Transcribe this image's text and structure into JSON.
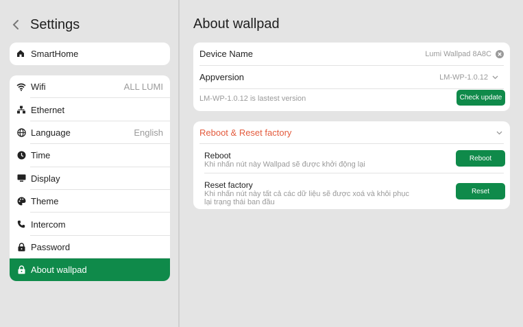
{
  "sidebar": {
    "title": "Settings",
    "home": "SmartHome",
    "items": [
      {
        "label": "Wifi",
        "value": "ALL LUMI",
        "icon": "wifi-icon"
      },
      {
        "label": "Ethernet",
        "value": "",
        "icon": "ethernet-icon"
      },
      {
        "label": "Language",
        "value": "English",
        "icon": "globe-icon"
      },
      {
        "label": "Time",
        "value": "",
        "icon": "clock-icon"
      },
      {
        "label": "Display",
        "value": "",
        "icon": "monitor-icon"
      },
      {
        "label": "Theme",
        "value": "",
        "icon": "palette-icon"
      },
      {
        "label": "Intercom",
        "value": "",
        "icon": "phone-icon"
      },
      {
        "label": "Password",
        "value": "",
        "icon": "lock-icon"
      },
      {
        "label": "About wallpad",
        "value": "",
        "icon": "lock-icon"
      }
    ]
  },
  "main": {
    "title": "About wallpad",
    "device_name_label": "Device Name",
    "device_name_value": "Lumi Wallpad 8A8C",
    "appversion_label": "Appversion",
    "appversion_value": "LM-WP-1.0.12",
    "latest_text": "LM-WP-1.0.12 is lastest version",
    "check_update": "Check update",
    "reset_section": "Reboot & Reset factory",
    "reboot_label": "Reboot",
    "reboot_desc": "Khi nhấn nút này Wallpad sẽ được khởi động lại",
    "reboot_button": "Reboot",
    "reset_label": "Reset factory",
    "reset_desc": "Khi nhấn nút này tất cả các dữ liệu sẽ được xoá và khôi phục lại trạng thái ban đầu",
    "reset_button": "Reset"
  },
  "colors": {
    "accent": "#0f8a4a",
    "section_title": "#e35a3c",
    "background": "#e4e4e4"
  }
}
